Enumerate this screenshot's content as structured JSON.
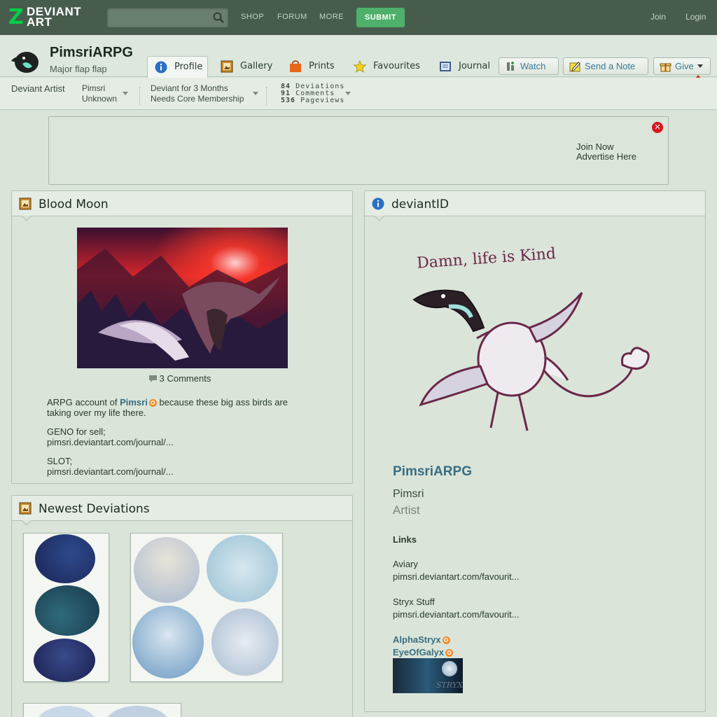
{
  "topbar": {
    "logo_line1": "DEVIANT",
    "logo_line2": "ART",
    "search_placeholder": "",
    "nav": [
      "SHOP",
      "FORUM",
      "MORE"
    ],
    "submit_label": "SUBMIT",
    "join_label": "Join",
    "login_label": "Login"
  },
  "profile": {
    "username": "PimsriARPG",
    "tagline": "Major flap flap",
    "tabs": [
      "Profile",
      "Gallery",
      "Prints",
      "Favourites",
      "Journal"
    ],
    "active_tab": "Profile",
    "buttons": {
      "watch": "Watch",
      "send_note": "Send a Note",
      "give": "Give"
    }
  },
  "stats": {
    "member_type": "Deviant Artist",
    "real_name": "Pimsri",
    "location": "Unknown",
    "membership_line1": "Deviant for 3 Months",
    "membership_line2": "Needs Core Membership",
    "deviations_count": "84",
    "deviations_label": "Deviations",
    "comments_count": "91",
    "comments_label": "Comments",
    "pageviews_count": "536",
    "pageviews_label": "Pageviews"
  },
  "ad": {
    "line1": "Join Now",
    "line2": "Advertise Here"
  },
  "featured": {
    "title": "Blood Moon",
    "comments": "3 Comments",
    "desc_prefix": "ARPG account of",
    "desc_link": "Pimsri",
    "desc_suffix": "because these big ass birds are",
    "desc_line2": "taking over my life there.",
    "geno_label": "GENO for sell;",
    "geno_link": "pimsri.deviantart.com/journal/...",
    "slot_label": "SLOT;",
    "slot_link": "pimsri.deviantart.com/journal/..."
  },
  "newest": {
    "title": "Newest Deviations"
  },
  "deviantid": {
    "title": "deviantID",
    "drawing_caption": "Damn, life is Kind",
    "username": "PimsriARPG",
    "real_name": "Pimsri",
    "role": "Artist",
    "links_heading": "Links",
    "link1_label": "Aviary",
    "link1_url": "pimsri.deviantart.com/favourit...",
    "link2_label": "Stryx Stuff",
    "link2_url": "pimsri.deviantart.com/favourit...",
    "friend1": "AlphaStryx",
    "friend2": "EyeOfGalyx",
    "banner_text": "STRYX"
  },
  "colors": {
    "topbar": "#475c4d",
    "brand_green": "#05cc47",
    "submit": "#4eb06a",
    "page_bg": "#dae4d9",
    "link": "#3a6d80"
  }
}
